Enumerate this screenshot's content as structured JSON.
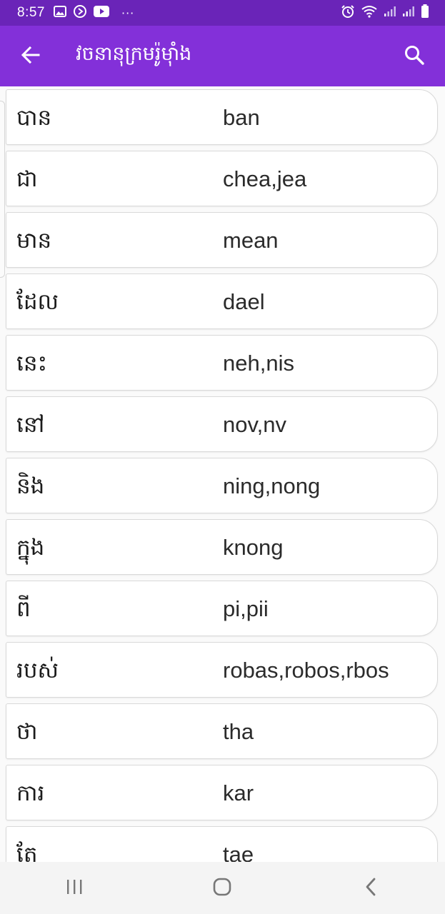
{
  "status_bar": {
    "time": "8:57",
    "left_icons": [
      "image-icon",
      "sync-icon",
      "youtube-icon",
      "more-dots-icon"
    ],
    "right_icons": [
      "alarm-icon",
      "wifi-icon",
      "signal-icon",
      "signal-icon",
      "battery-icon"
    ],
    "more_dots": "···"
  },
  "app_bar": {
    "title": "វចនានុក្រមរ៉ូម៉ាំង",
    "color": "#8330d9",
    "status_color": "#6a24b8"
  },
  "words": [
    {
      "khmer": "បាន",
      "roman": "ban"
    },
    {
      "khmer": "ជា",
      "roman": "chea,jea"
    },
    {
      "khmer": "មាន",
      "roman": "mean"
    },
    {
      "khmer": "ដែល",
      "roman": "dael"
    },
    {
      "khmer": "នេះ",
      "roman": "neh,nis"
    },
    {
      "khmer": "នៅ",
      "roman": "nov,nv"
    },
    {
      "khmer": "និង",
      "roman": "ning,nong"
    },
    {
      "khmer": "ក្នុង",
      "roman": "knong"
    },
    {
      "khmer": "ពី",
      "roman": "pi,pii"
    },
    {
      "khmer": "របស់",
      "roman": "robas,robos,rbos"
    },
    {
      "khmer": "ថា",
      "roman": "tha"
    },
    {
      "khmer": "ការ",
      "roman": "kar"
    },
    {
      "khmer": "តែ",
      "roman": "tae"
    }
  ],
  "nav_bar": {
    "buttons": [
      "recent-apps-icon",
      "home-icon",
      "back-icon"
    ]
  }
}
